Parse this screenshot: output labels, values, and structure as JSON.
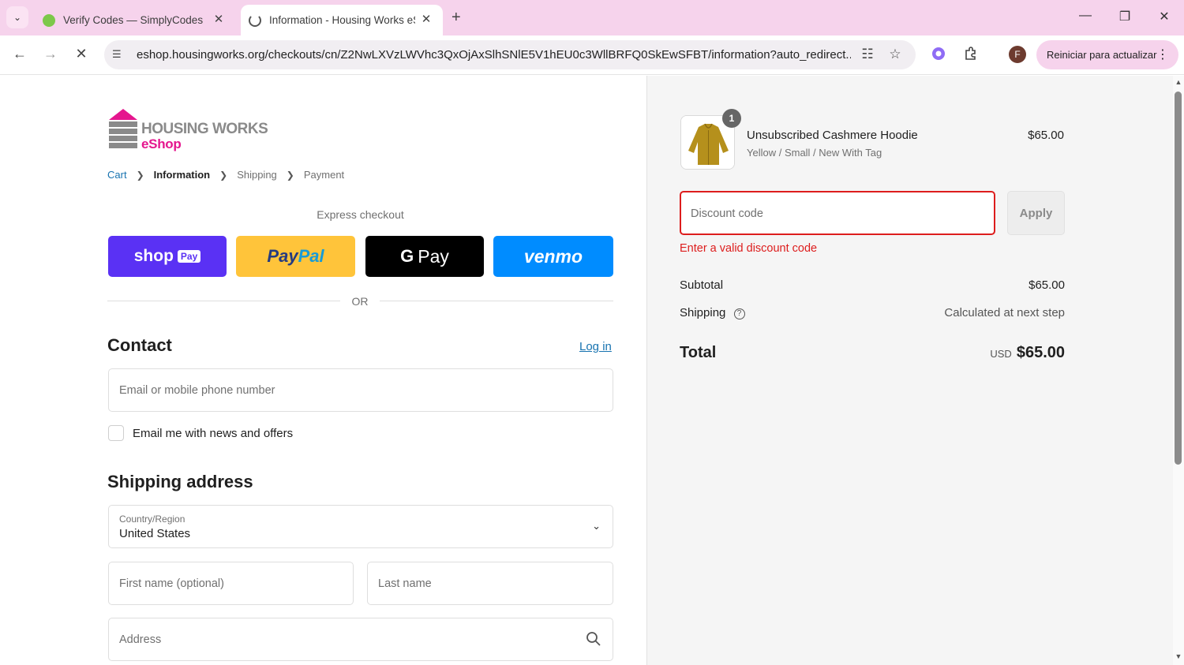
{
  "browser": {
    "tabs": [
      {
        "title": "Verify Codes — SimplyCodes",
        "active": false
      },
      {
        "title": "Information - Housing Works eShop",
        "active": true
      }
    ],
    "url": "eshop.housingworks.org/checkouts/cn/Z2NwLXVzLWVhc3QxOjAxSlhSNlE5V1hEU0c3WllBRFQ0SkEwSFBT/information?auto_redirect...",
    "restart_label": "Reiniciar para actualizar",
    "profile_initial": "F"
  },
  "brand": {
    "line1": "HOUSING WORKS",
    "line2": "eShop",
    "colors": {
      "pink": "#e5168e",
      "gray": "#8a8a8a"
    }
  },
  "breadcrumb": {
    "cart": "Cart",
    "information": "Information",
    "shipping": "Shipping",
    "payment": "Payment"
  },
  "express": {
    "heading": "Express checkout",
    "shop": "shop",
    "shop_pay": "Pay",
    "paypal_a": "Pay",
    "paypal_b": "Pal",
    "gpay_g": "G",
    "gpay": "Pay",
    "venmo": "venmo",
    "or": "OR"
  },
  "contact": {
    "heading": "Contact",
    "login": "Log in",
    "email_placeholder": "Email or mobile phone number",
    "newsletter_label": "Email me with news and offers"
  },
  "shipping": {
    "heading": "Shipping address",
    "country_label": "Country/Region",
    "country_value": "United States",
    "first_name_placeholder": "First name (optional)",
    "last_name_placeholder": "Last name",
    "address_placeholder": "Address"
  },
  "summary": {
    "item": {
      "quantity": "1",
      "name": "Unsubscribed Cashmere Hoodie",
      "variant": "Yellow / Small / New With Tag",
      "price": "$65.00"
    },
    "discount_placeholder": "Discount code",
    "apply_label": "Apply",
    "discount_error": "Enter a valid discount code",
    "subtotal_label": "Subtotal",
    "subtotal_value": "$65.00",
    "shipping_label": "Shipping",
    "shipping_value": "Calculated at next step",
    "total_label": "Total",
    "total_currency": "USD",
    "total_value": "$65.00"
  },
  "icons": [
    "chevron-down-icon",
    "close-icon",
    "plus-icon",
    "minimize-icon",
    "restore-icon",
    "back-icon",
    "forward-icon",
    "stop-icon",
    "site-info-icon",
    "translate-icon",
    "star-icon",
    "extension-icon",
    "puzzle-icon",
    "menu-icon",
    "search-icon",
    "help-icon"
  ]
}
